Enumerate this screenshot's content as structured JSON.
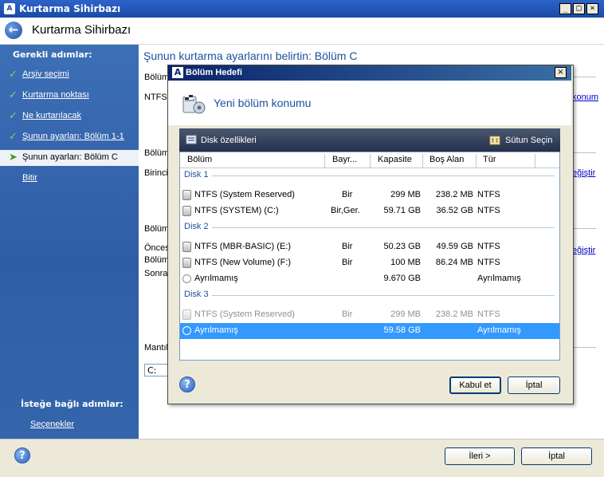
{
  "window": {
    "title": "Kurtarma Sihirbazı",
    "app_icon": "acronis-icon",
    "minimize": "_",
    "maximize": "□",
    "close": "×"
  },
  "header": {
    "title": "Kurtarma Sihirbazı",
    "back_icon": "back-arrow-icon"
  },
  "sidebar": {
    "required_heading": "Gerekli adımlar:",
    "steps": [
      {
        "label": "Arşiv seçimi",
        "done": true
      },
      {
        "label": "Kurtarma noktası",
        "done": true
      },
      {
        "label": "Ne kurtarılacak",
        "done": true
      },
      {
        "label": "Şunun ayarları: Bölüm 1-1",
        "done": true
      },
      {
        "label": "Şunun ayarları: Bölüm C",
        "current": true
      },
      {
        "label": "Bitir"
      }
    ],
    "optional_heading": "İsteğe bağlı adımlar:",
    "options_link": "Seçenekler"
  },
  "content": {
    "heading": "Şunun kurtarma ayarlarını belirtin: Bölüm C",
    "labels": {
      "bolum1": "Bölüm",
      "ntfs": "NTFS",
      "bolum2": "Bölüm",
      "birincil": "Birincil",
      "bolum3": "Bölüm",
      "oncesi": "Öncesi",
      "bolum4": "Bölüm",
      "sonra": "Sonra",
      "mantik": "Mantık"
    },
    "links": {
      "konum": "konum",
      "degistir1": "eğiştir",
      "degistir2": "eğiştir"
    },
    "drive_value": "C:"
  },
  "footer": {
    "help_icon": "help-icon",
    "next": "İleri >",
    "cancel": "İptal"
  },
  "modal": {
    "title": "Bölüm Hedefi",
    "close": "×",
    "banner_title": "Yeni bölüm konumu",
    "toolbar": {
      "disk_properties": "Disk özellikleri",
      "choose_columns": "Sütun Seçin"
    },
    "columns": [
      "Bölüm",
      "Bayr...",
      "Kapasite",
      "Boş Alan",
      "Tür"
    ],
    "groups": [
      {
        "name": "Disk 1",
        "rows": [
          {
            "icon": "disk",
            "name": "NTFS (System Reserved)",
            "flags": "Bir",
            "capacity": "299 MB",
            "free": "238.2 MB",
            "type": "NTFS"
          },
          {
            "icon": "disk",
            "name": "NTFS (SYSTEM) (C:)",
            "flags": "Bir,Ger.",
            "capacity": "59.71 GB",
            "free": "36.52 GB",
            "type": "NTFS"
          }
        ]
      },
      {
        "name": "Disk 2",
        "rows": [
          {
            "icon": "disk",
            "name": "NTFS (MBR-BASIC) (E:)",
            "flags": "Bir",
            "capacity": "50.23 GB",
            "free": "49.59 GB",
            "type": "NTFS"
          },
          {
            "icon": "disk",
            "name": "NTFS (New Volume) (F:)",
            "flags": "Bir",
            "capacity": "100 MB",
            "free": "86.24 MB",
            "type": "NTFS"
          },
          {
            "icon": "circle",
            "name": "Ayrılmamış",
            "flags": "",
            "capacity": "9.670 GB",
            "free": "",
            "type": "Ayrılmamış"
          }
        ]
      },
      {
        "name": "Disk 3",
        "rows": [
          {
            "icon": "disk",
            "name": "NTFS (System Reserved)",
            "flags": "Bir",
            "capacity": "299 MB",
            "free": "238.2 MB",
            "type": "NTFS",
            "disabled": true
          },
          {
            "icon": "circle",
            "name": "Ayrılmamış",
            "flags": "",
            "capacity": "59.58 GB",
            "free": "",
            "type": "Ayrılmamış",
            "selected": true
          }
        ]
      }
    ],
    "ok": "Kabul et",
    "cancel": "İptal"
  }
}
